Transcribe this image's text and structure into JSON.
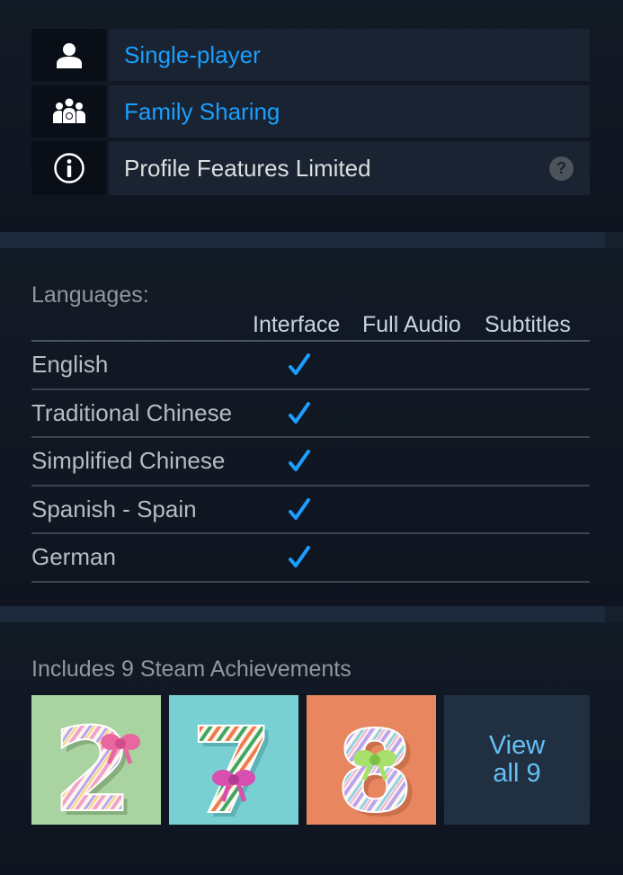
{
  "features": [
    {
      "label": "Single-player",
      "icon": "single-player-icon"
    },
    {
      "label": "Family Sharing",
      "icon": "family-sharing-icon"
    },
    {
      "label": "Profile Features Limited",
      "icon": "info-icon",
      "help": "?"
    }
  ],
  "languages": {
    "title": "Languages:",
    "columns": [
      "Interface",
      "Full Audio",
      "Subtitles"
    ],
    "check_glyph": "✓",
    "rows": [
      {
        "name": "English",
        "interface": true,
        "full_audio": false,
        "subtitles": false
      },
      {
        "name": "Traditional Chinese",
        "interface": true,
        "full_audio": false,
        "subtitles": false
      },
      {
        "name": "Simplified Chinese",
        "interface": true,
        "full_audio": false,
        "subtitles": false
      },
      {
        "name": "Spanish - Spain",
        "interface": true,
        "full_audio": false,
        "subtitles": false
      },
      {
        "name": "German",
        "interface": true,
        "full_audio": false,
        "subtitles": false
      }
    ]
  },
  "achievements": {
    "title": "Includes 9 Steam Achievements",
    "tiles": [
      {
        "digit": "2",
        "bg": "#a9d3a0"
      },
      {
        "digit": "7",
        "bg": "#78d0d3"
      },
      {
        "digit": "8",
        "bg": "#e8875f"
      }
    ],
    "view_all_line1": "View",
    "view_all_line2": "all 9"
  },
  "colors": {
    "link": "#1a9fff",
    "check": "#1a9fff"
  }
}
